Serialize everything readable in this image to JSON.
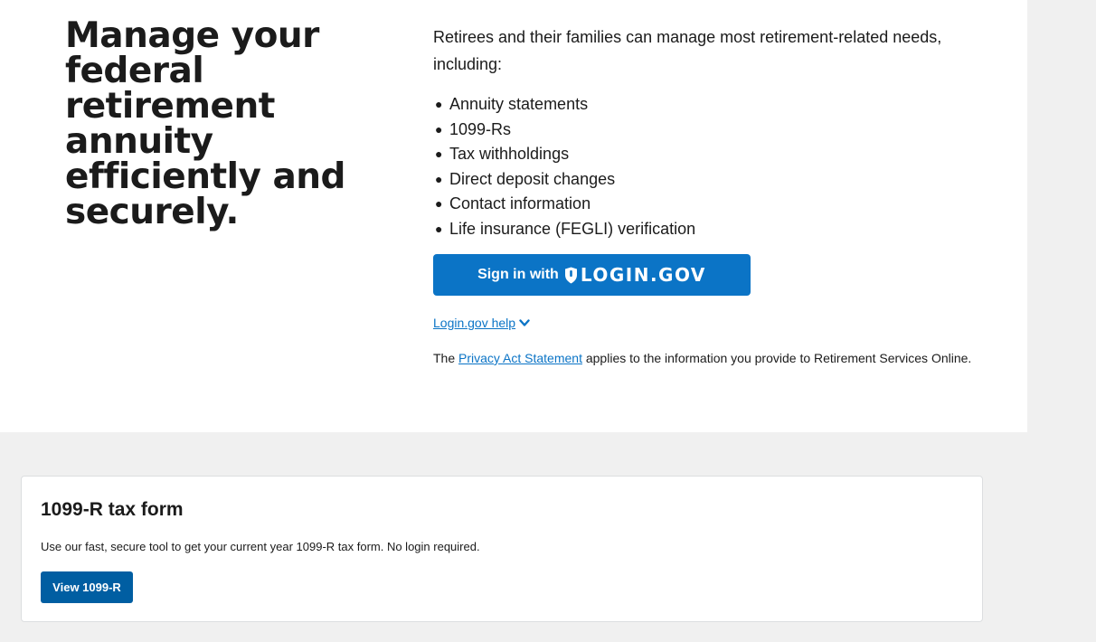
{
  "hero": {
    "headline": "Manage your federal retirement annuity efficiently and securely.",
    "intro": "Retirees and their families can manage most retirement-related needs, including:",
    "needs": [
      "Annuity statements",
      "1099-Rs",
      "Tax withholdings",
      "Direct deposit changes",
      "Contact information",
      "Life insurance (FEGLI) verification"
    ],
    "login_button": {
      "sign_in_label": "Sign in with",
      "brand_label": "LOGIN.GOV",
      "icon": "shield-icon"
    },
    "help_link": {
      "label": "Login.gov help",
      "icon": "chevron-down-icon"
    },
    "privacy": {
      "prefix": "The",
      "link_label": "Privacy Act Statement",
      "suffix": "applies to the information you provide to Retirement Services Online."
    }
  },
  "card_1099r": {
    "title": "1099-R tax form",
    "description": "Use our fast, secure tool to get your current year 1099-R tax form. No login required.",
    "button_label": "View 1099-R"
  },
  "colors": {
    "login_blue": "#0b74c6",
    "button_navy": "#005ea2",
    "band_gray": "#f0f0f0",
    "text": "#1b1b1b"
  }
}
